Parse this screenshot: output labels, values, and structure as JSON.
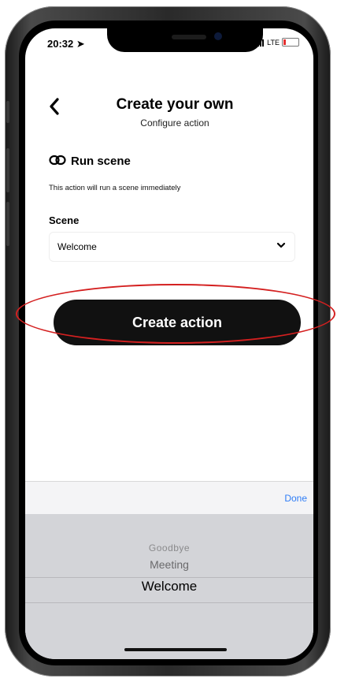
{
  "status_bar": {
    "time": "20:32",
    "network": "LTE"
  },
  "header": {
    "title": "Create your own",
    "subtitle": "Configure action"
  },
  "service": {
    "name": "Run scene",
    "description": "This action will run a scene immediately"
  },
  "scene_field": {
    "label": "Scene",
    "value": "Welcome"
  },
  "create_button": {
    "label": "Create action"
  },
  "picker": {
    "done_label": "Done",
    "options": [
      "Goodbye",
      "Meeting",
      "Welcome"
    ],
    "selected": "Welcome"
  },
  "colors": {
    "accent": "#2f7df6",
    "annotation": "#d42020",
    "button_bg": "#111111"
  }
}
